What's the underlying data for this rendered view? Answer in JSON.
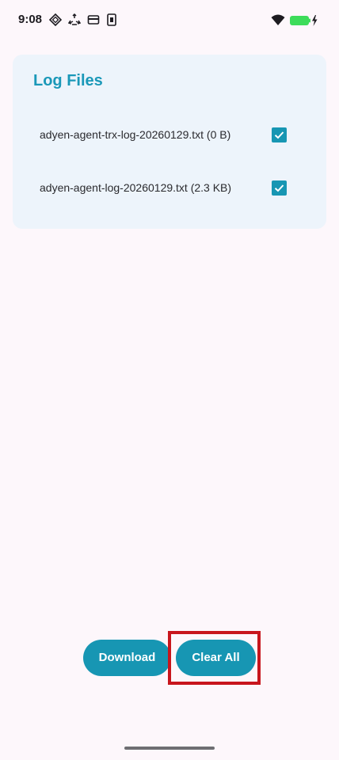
{
  "status_bar": {
    "time": "9:08",
    "icons": [
      "location-diamond-icon",
      "recycle-icon",
      "card-icon",
      "device-icon",
      "wifi-icon",
      "battery-charging-icon"
    ],
    "battery_color": "#3ddc5a"
  },
  "card": {
    "title": "Log Files",
    "files": [
      {
        "label": "adyen-agent-trx-log-20260129.txt (0 B)",
        "checked": true
      },
      {
        "label": "adyen-agent-log-20260129.txt (2.3 KB)",
        "checked": true
      }
    ]
  },
  "actions": {
    "download_label": "Download",
    "clear_all_label": "Clear All"
  },
  "colors": {
    "accent": "#1796b3",
    "title": "#1a98b8",
    "card_bg": "#edf4fb",
    "page_bg": "#fdf7fb",
    "highlight": "#c8161d"
  }
}
